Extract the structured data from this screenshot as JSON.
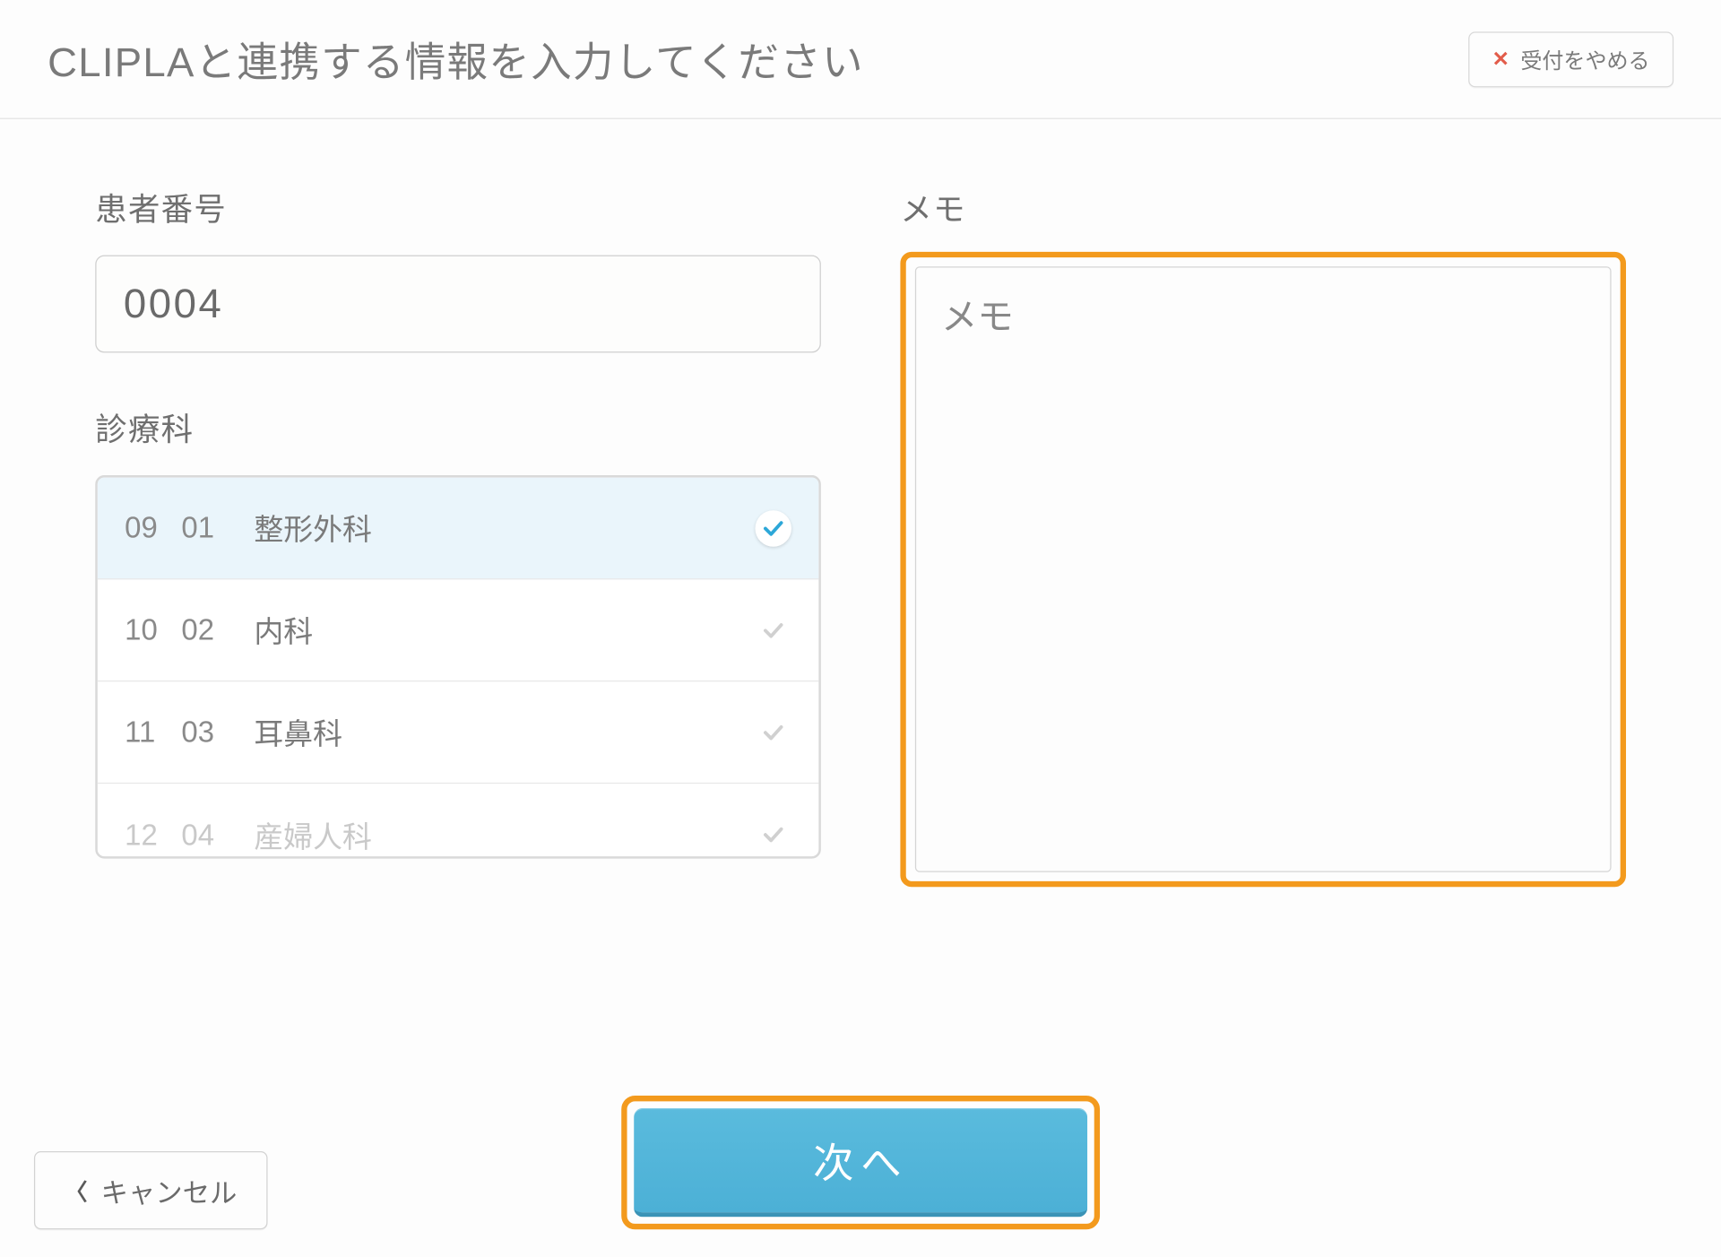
{
  "header": {
    "title": "CLIPLAと連携する情報を入力してください",
    "stop_label": "受付をやめる"
  },
  "patient": {
    "label": "患者番号",
    "value": "0004"
  },
  "department": {
    "label": "診療科",
    "items": [
      {
        "n1": "09",
        "n2": "01",
        "name": "整形外科",
        "selected": true
      },
      {
        "n1": "10",
        "n2": "02",
        "name": "内科",
        "selected": false
      },
      {
        "n1": "11",
        "n2": "03",
        "name": "耳鼻科",
        "selected": false
      },
      {
        "n1": "12",
        "n2": "04",
        "name": "産婦人科",
        "selected": false
      }
    ]
  },
  "memo": {
    "label": "メモ",
    "placeholder": "メモ",
    "value": ""
  },
  "footer": {
    "cancel_label": "キャンセル",
    "next_label": "次へ"
  },
  "colors": {
    "highlight": "#f39a1d",
    "primary": "#4cb0d6"
  }
}
